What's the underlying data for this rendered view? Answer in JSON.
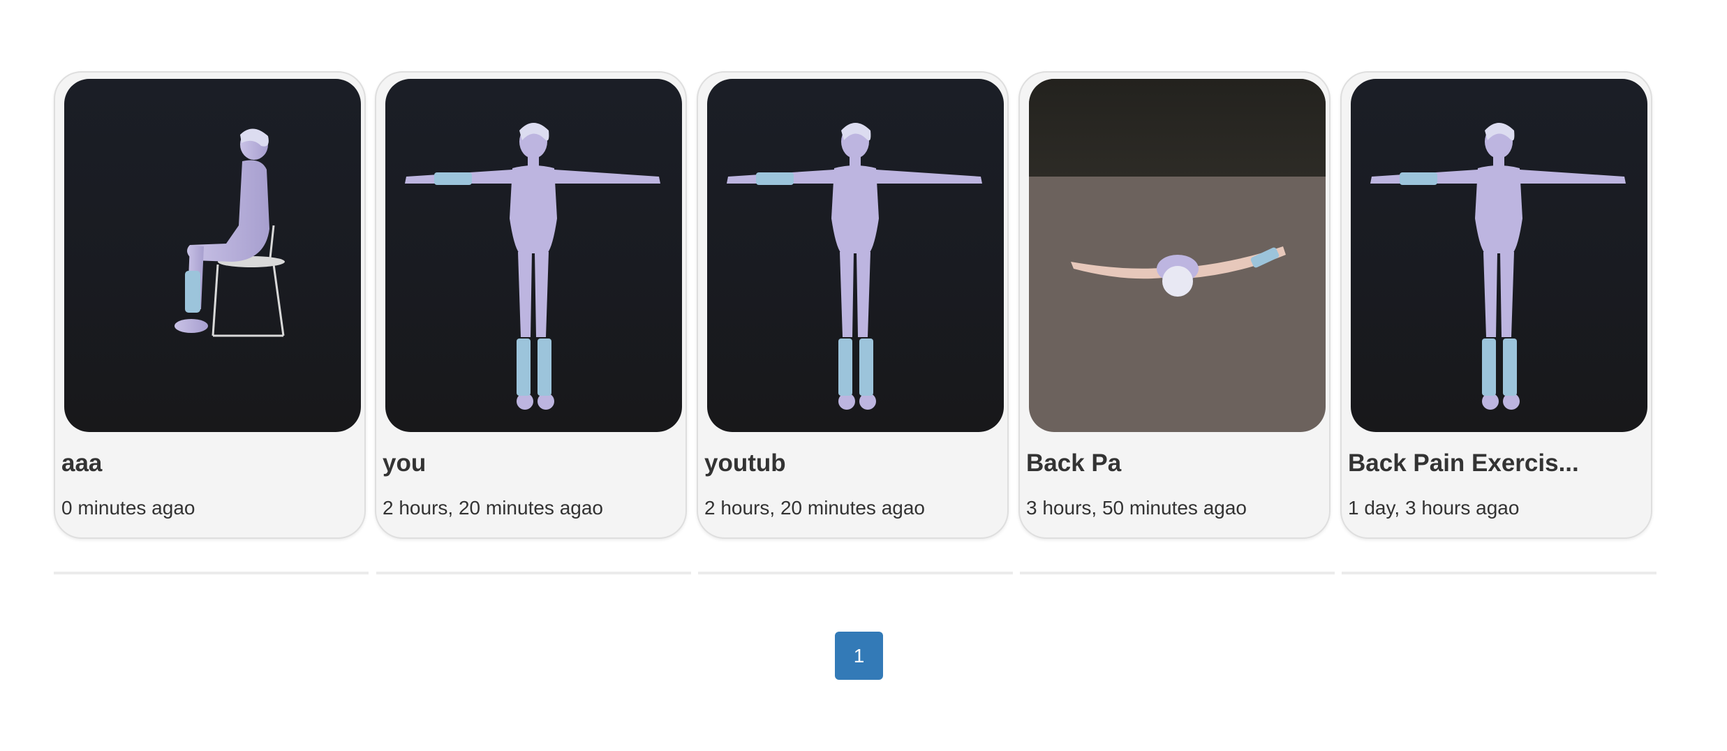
{
  "cards": [
    {
      "title": "aaa",
      "time": "0 minutes agao",
      "thumbnail": "avatar-seated-side-view"
    },
    {
      "title": "you",
      "time": "2 hours, 20 minutes agao",
      "thumbnail": "avatar-t-pose-front-view"
    },
    {
      "title": "youtub",
      "time": "2 hours, 20 minutes agao",
      "thumbnail": "avatar-t-pose-front-view"
    },
    {
      "title": "Back Pa",
      "time": "3 hours, 50 minutes agao",
      "thumbnail": "avatar-t-pose-top-view"
    },
    {
      "title": "Back Pain Exercis...",
      "time": "1 day, 3 hours agao",
      "thumbnail": "avatar-t-pose-front-view"
    }
  ],
  "pagination": {
    "current_page": "1"
  },
  "colors": {
    "card_background": "#f4f4f4",
    "thumbnail_background": "#1a1c22",
    "pager_active": "#337ab7",
    "text": "#333333"
  }
}
